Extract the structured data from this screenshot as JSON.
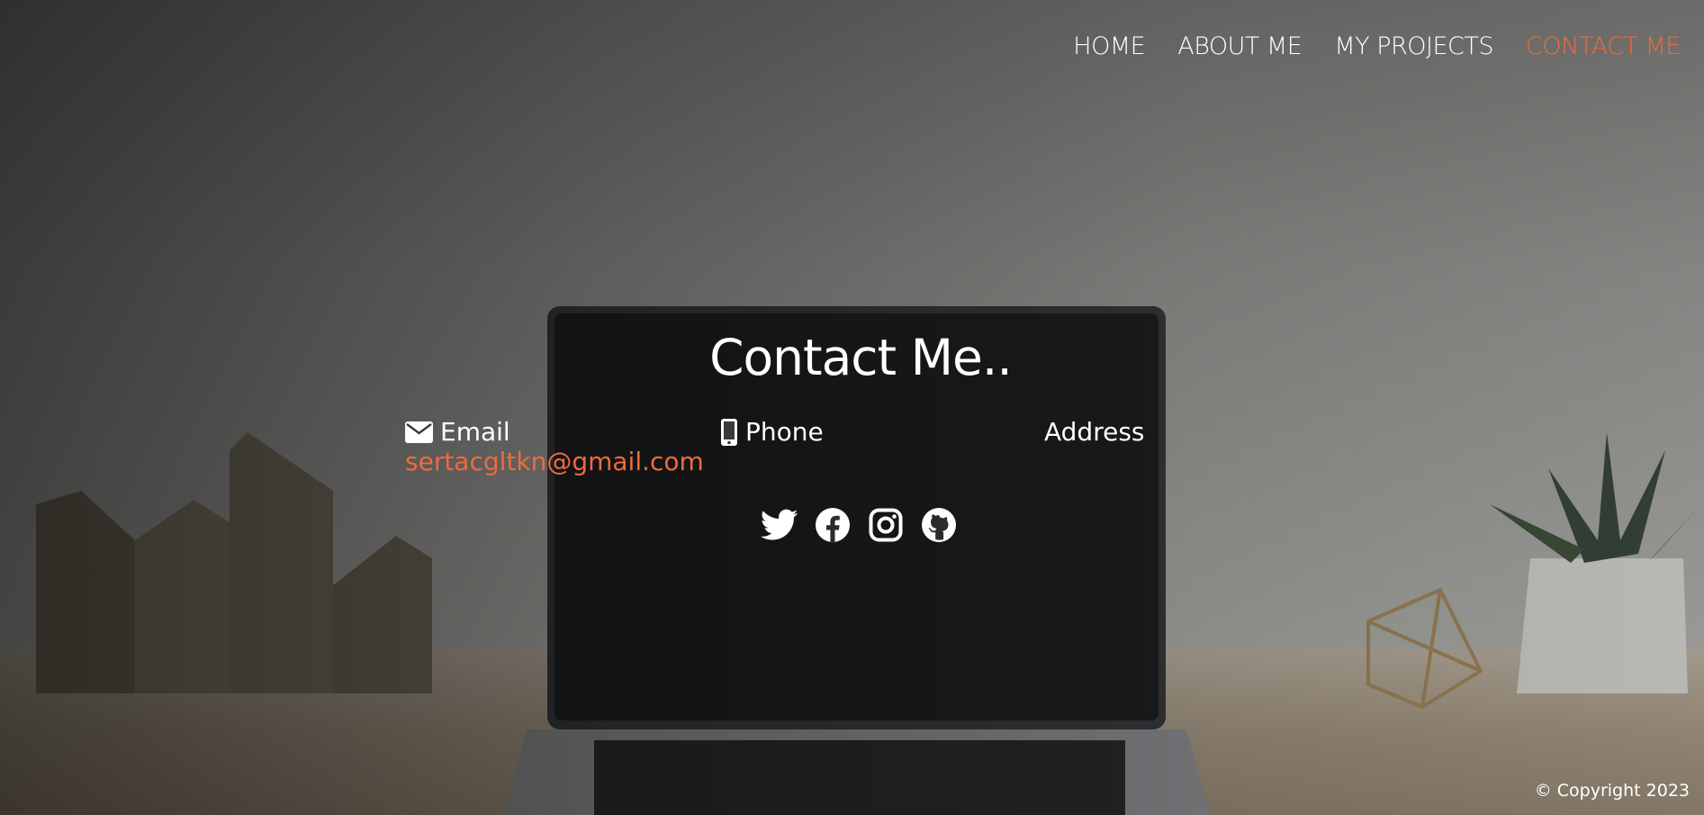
{
  "nav": {
    "items": [
      {
        "label": "HOME",
        "active": false
      },
      {
        "label": "ABOUT ME",
        "active": false
      },
      {
        "label": "MY PROJECTS",
        "active": false
      },
      {
        "label": "CONTACT ME",
        "active": true
      }
    ]
  },
  "contact": {
    "title": "Contact Me..",
    "email_label": "Email",
    "email_value": "sertacgltkn@gmail.com",
    "phone_label": "Phone",
    "address_label": "Address"
  },
  "social_icons": [
    "twitter-icon",
    "facebook-icon",
    "instagram-icon",
    "github-icon"
  ],
  "footer": {
    "copyright": "© Copyright 2023"
  },
  "colors": {
    "accent": "#ef6a3d",
    "text": "#ffffff"
  }
}
